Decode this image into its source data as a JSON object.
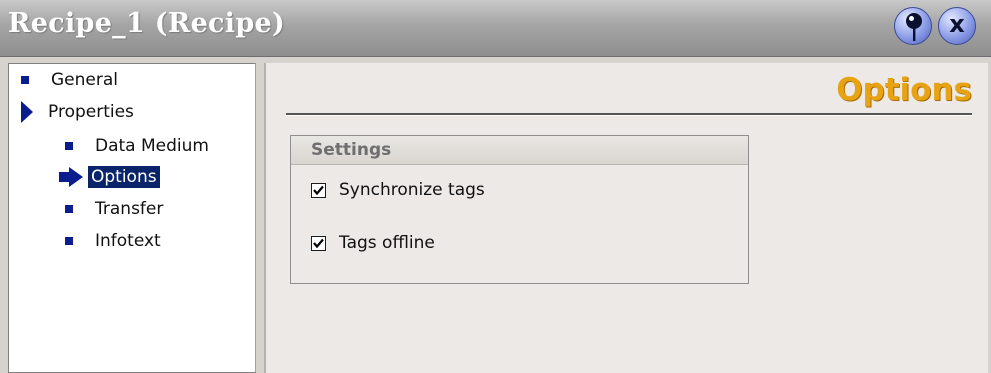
{
  "window": {
    "title": "Recipe_1 (Recipe)",
    "buttons": {
      "pin": "pin-icon",
      "close": "close-icon",
      "close_glyph": "x"
    }
  },
  "nav": {
    "items": [
      {
        "label": "General",
        "level": 0,
        "icon": "square-bullet-icon",
        "selected": false
      },
      {
        "label": "Properties",
        "level": 0,
        "icon": "expand-arrow-icon",
        "selected": false
      },
      {
        "label": "Data Medium",
        "level": 1,
        "icon": "square-bullet-icon",
        "selected": false
      },
      {
        "label": "Options",
        "level": 1,
        "icon": "current-arrow-icon",
        "selected": true
      },
      {
        "label": "Transfer",
        "level": 1,
        "icon": "square-bullet-icon",
        "selected": false
      },
      {
        "label": "Infotext",
        "level": 1,
        "icon": "square-bullet-icon",
        "selected": false
      }
    ]
  },
  "content": {
    "title": "Options",
    "settings": {
      "title": "Settings",
      "options": [
        {
          "label": "Synchronize tags",
          "checked": true
        },
        {
          "label": "Tags offline",
          "checked": true
        }
      ]
    }
  },
  "colors": {
    "accent_title": "#e8a315",
    "selection": "#0a246a",
    "bullet": "#0a1d8c"
  }
}
